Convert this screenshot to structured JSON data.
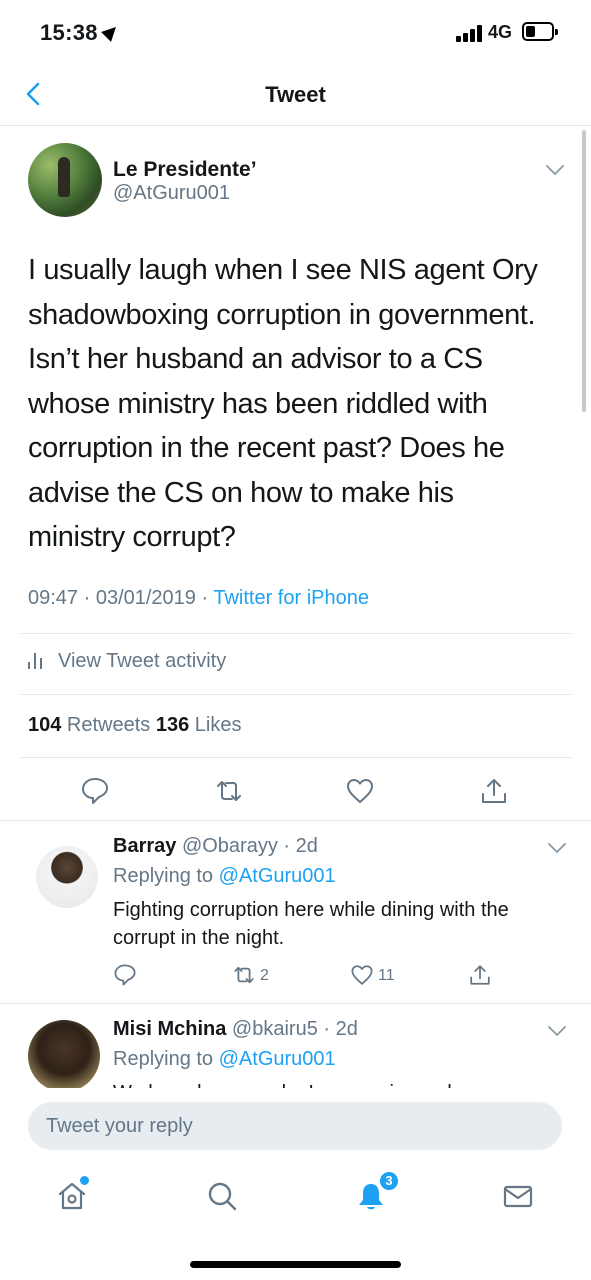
{
  "status_bar": {
    "time": "15:38",
    "network": "4G"
  },
  "header": {
    "title": "Tweet"
  },
  "tweet": {
    "author_name": "Le Presidente’",
    "author_handle": "@AtGuru001",
    "text_lines": [
      "I usually laugh when I see NIS agent Ory",
      "shadowboxing corruption in government.",
      "Isn’t her husband an advisor to a CS",
      "whose ministry has been riddled with",
      "corruption in the recent past? Does he",
      "advise the CS on how to make his",
      "ministry corrupt?"
    ],
    "timestamp": "09:47 · 03/01/2019 · ",
    "source": "Twitter for iPhone",
    "activity_label": "View Tweet activity",
    "retweet_count": "104",
    "retweet_label": " Retweets ",
    "like_count": "136",
    "like_label": " Likes"
  },
  "replies": [
    {
      "name": "Barray",
      "meta": " @Obarayy · 2d",
      "replying_prefix": "Replying to ",
      "replying_handle": "@AtGuru001",
      "text": "Fighting corruption here while dining with the corrupt in the night.",
      "retweets": "2",
      "likes": "11"
    },
    {
      "name": "Misi Mchina",
      "meta": " @bkairu5 · 2d",
      "replying_prefix": "Replying to ",
      "replying_handle": "@AtGuru001",
      "text": "We have been made. I say again, we have"
    }
  ],
  "composer": {
    "placeholder": "Tweet your reply"
  },
  "tab_bar": {
    "notification_badge": "3"
  },
  "colors": {
    "accent": "#1da1f2",
    "secondary_text": "#657786",
    "divider": "#e1e8ed"
  }
}
